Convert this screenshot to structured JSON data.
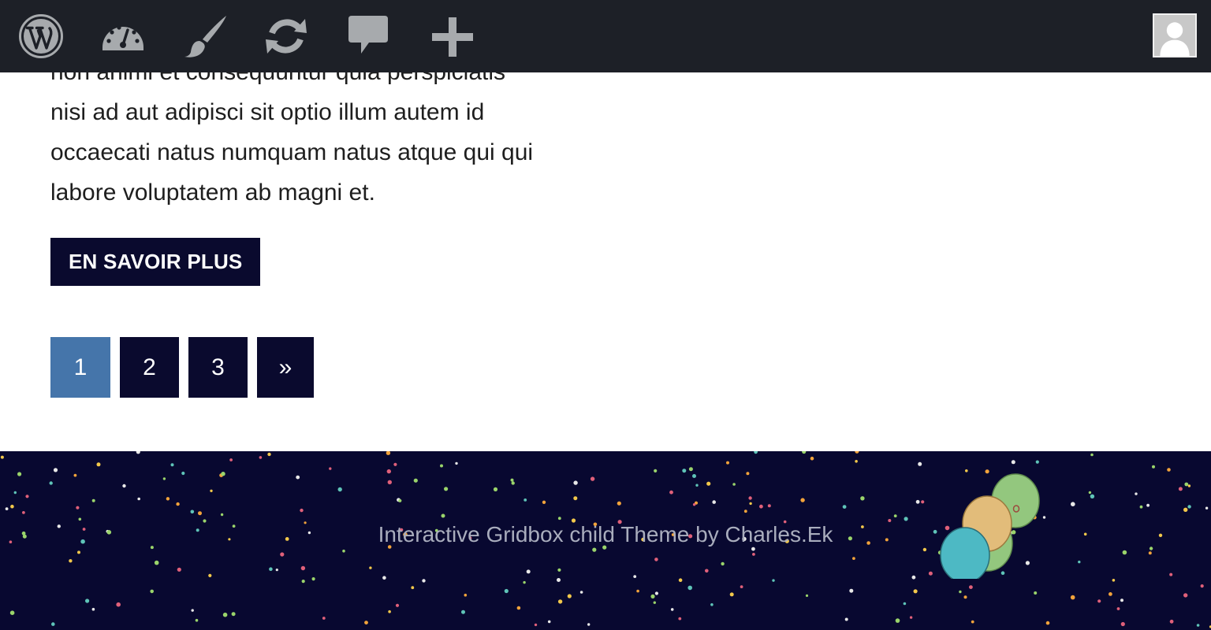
{
  "admin_bar": {
    "icons": [
      "wordpress-logo-icon",
      "dashboard-icon",
      "customize-brush-icon",
      "updates-icon",
      "comments-icon",
      "new-content-plus-icon"
    ],
    "background": "#1d2027",
    "icon_color": "#a7aaad",
    "avatar": "user-avatar-icon"
  },
  "post": {
    "excerpt_lines": [
      "non animi et consequuntur quia perspiciatis",
      "nisi ad aut adipisci sit optio illum autem id",
      "occaecati natus numquam natus atque qui qui",
      "labore voluptatem ab magni et."
    ],
    "read_more_label": "EN SAVOIR PLUS"
  },
  "pagination": {
    "current": "1",
    "pages": [
      "1",
      "2",
      "3"
    ],
    "next_label": "»",
    "current_color": "#4575aa",
    "color": "#0a0a2e"
  },
  "footer": {
    "credit": "Interactive Gridbox child Theme by Charles.Ek",
    "background": "#080830",
    "balloon_colors": [
      "#93c77e",
      "#e2bc7a",
      "#4db9c4"
    ]
  }
}
